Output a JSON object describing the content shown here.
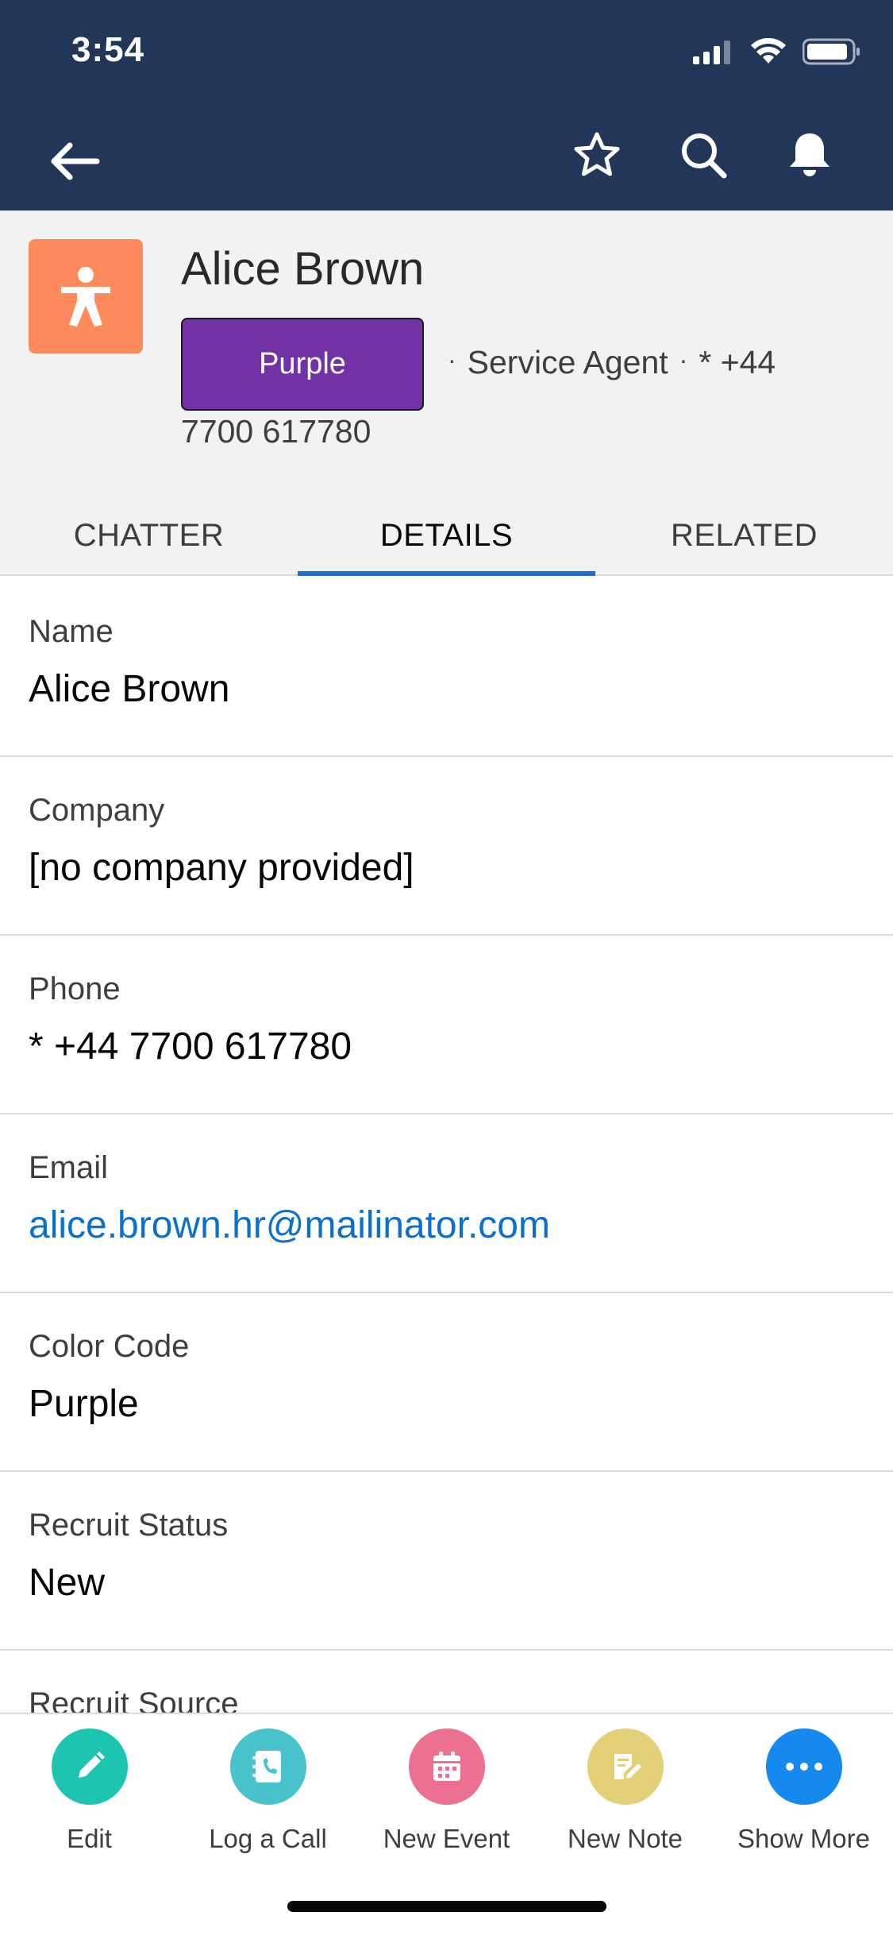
{
  "status_bar": {
    "time": "3:54"
  },
  "record": {
    "name": "Alice Brown",
    "badge": "Purple",
    "role": "Service Agent",
    "phone_prefix": "* +44",
    "phone_rest": "7700 617780"
  },
  "tabs": [
    {
      "label": "CHATTER"
    },
    {
      "label": "DETAILS"
    },
    {
      "label": "RELATED"
    }
  ],
  "fields": [
    {
      "label": "Name",
      "value": "Alice Brown"
    },
    {
      "label": "Company",
      "value": "[no company provided]"
    },
    {
      "label": "Phone",
      "value": "* +44 7700 617780"
    },
    {
      "label": "Email",
      "value": "alice.brown.hr@mailinator.com"
    },
    {
      "label": "Color Code",
      "value": "Purple"
    },
    {
      "label": "Recruit Status",
      "value": "New"
    },
    {
      "label": "Recruit Source",
      "value": ""
    }
  ],
  "actions": [
    {
      "label": "Edit",
      "icon": "pencil-icon",
      "color": "#1dc5b0"
    },
    {
      "label": "Log a Call",
      "icon": "phone-book-icon",
      "color": "#48c3cc"
    },
    {
      "label": "New Event",
      "icon": "calendar-icon",
      "color": "#eb7092"
    },
    {
      "label": "New Note",
      "icon": "note-icon",
      "color": "#e3d076"
    },
    {
      "label": "Show More",
      "icon": "more-icon",
      "color": "#1589ee"
    }
  ],
  "colors": {
    "header_bg": "#22365a",
    "avatar_bg": "#ff8a5c",
    "badge_bg": "#7231a4",
    "tab_active": "#1b6ed0",
    "link": "#0b6fcc"
  }
}
